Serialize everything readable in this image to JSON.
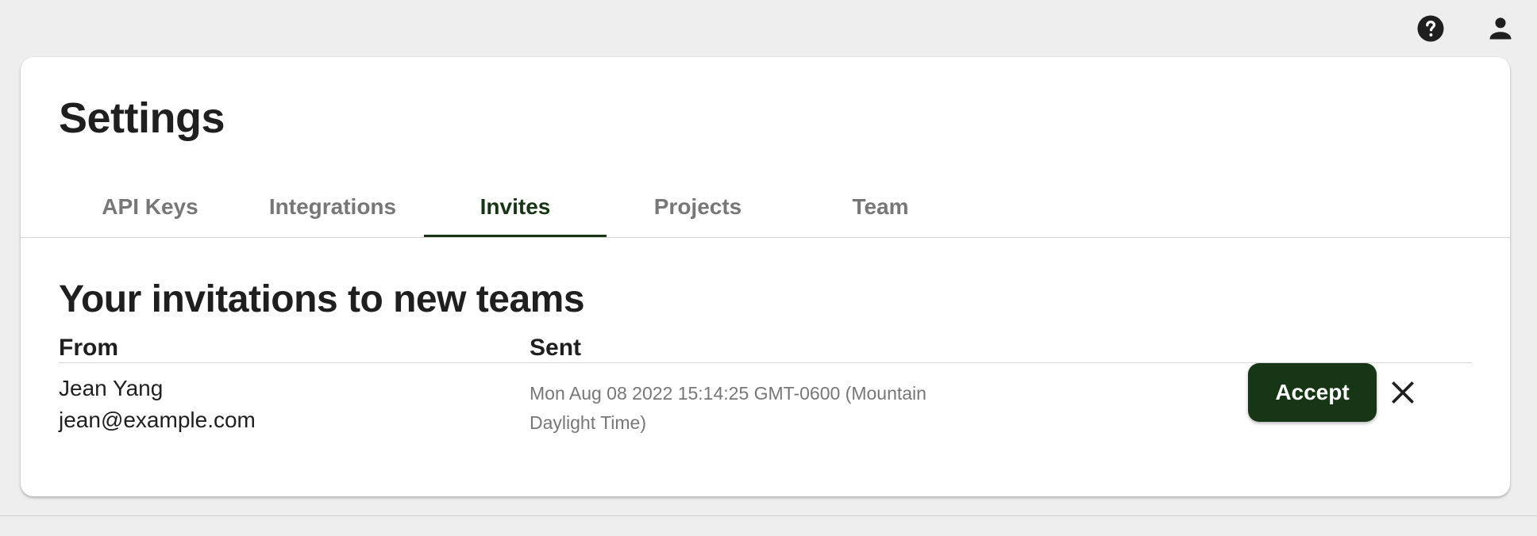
{
  "topbar": {
    "help_icon": "help-circle-icon",
    "account_icon": "person-icon"
  },
  "settings": {
    "title": "Settings",
    "tabs": [
      {
        "label": "API Keys",
        "active": false
      },
      {
        "label": "Integrations",
        "active": false
      },
      {
        "label": "Invites",
        "active": true
      },
      {
        "label": "Projects",
        "active": false
      },
      {
        "label": "Team",
        "active": false
      }
    ]
  },
  "invites": {
    "section_title": "Your invitations to new teams",
    "columns": {
      "from": "From",
      "sent": "Sent"
    },
    "rows": [
      {
        "name": "Jean Yang",
        "email": "jean@example.com",
        "sent": "Mon Aug 08 2022 15:14:25 GMT-0600 (Mountain Daylight Time)",
        "accept_label": "Accept",
        "decline_icon": "close-icon"
      }
    ]
  },
  "colors": {
    "accent": "#173616",
    "background": "#eeeeee",
    "card": "#ffffff",
    "muted_text": "#777777"
  }
}
